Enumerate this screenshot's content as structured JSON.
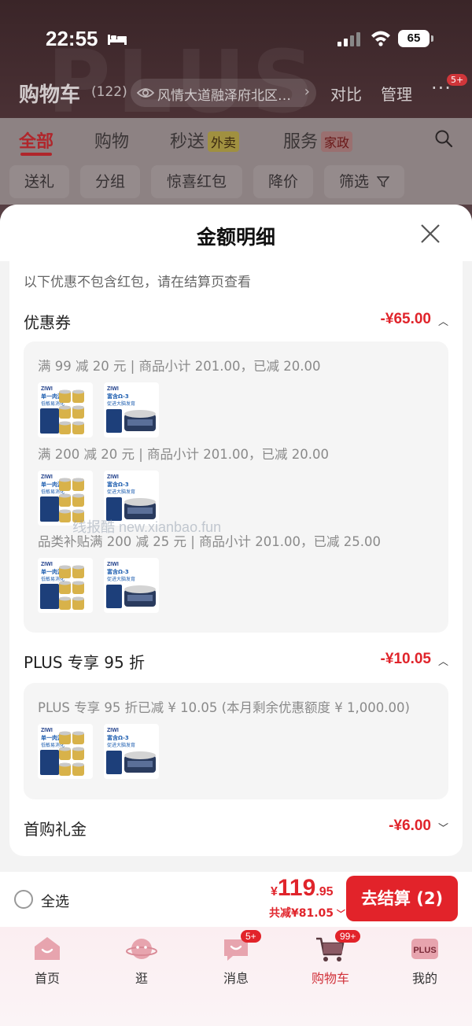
{
  "status_bar": {
    "time": "22:55",
    "battery": "65"
  },
  "header": {
    "title": "购物车",
    "count": "(122)",
    "address": "风情大道融泽府北区…",
    "compare": "对比",
    "manage": "管理",
    "more_badge": "5+"
  },
  "tabs": [
    {
      "label": "全部"
    },
    {
      "label": "购物"
    },
    {
      "label": "秒送",
      "tag": "外卖"
    },
    {
      "label": "服务",
      "tag": "家政"
    }
  ],
  "chips": [
    "送礼",
    "分组",
    "惊喜红包",
    "降价",
    "筛选"
  ],
  "sheet": {
    "title": "金额明细",
    "notice": "以下优惠不包含红包，请在结算页查看",
    "coupon": {
      "title": "优惠券",
      "amount": "-¥65.00",
      "rules": [
        "满 99 减 20 元 | 商品小计 201.00，已减 20.00",
        "满 200 减 20 元 | 商品小计 201.00，已减 20.00",
        "品类补贴满 200 减 25 元 | 商品小计 201.00，已减 25.00"
      ]
    },
    "plus": {
      "title": "PLUS 专享 95 折",
      "amount": "-¥10.05",
      "rule": "PLUS 专享 95 折已减 ¥ 10.05 (本月剩余优惠额度 ¥ 1,000.00)"
    },
    "first_gift": {
      "title": "首购礼金",
      "amount": "-¥6.00"
    },
    "products": [
      {
        "brand": "ZIWI",
        "line1": "单一肉源",
        "line2": "低敏易消化"
      },
      {
        "brand": "ZIWI",
        "line1": "富含Ω-3",
        "line2": "促进大脑发育"
      }
    ],
    "watermark": "线报酷 new.xianbao.fun"
  },
  "checkout": {
    "select_all": "全选",
    "price_symbol": "¥",
    "price_int": "119",
    "price_dec": ".95",
    "saved": "共减¥81.05",
    "button": "去结算 (2)"
  },
  "tabbar": [
    {
      "label": "首页",
      "icon": "home-icon"
    },
    {
      "label": "逛",
      "icon": "planet-icon"
    },
    {
      "label": "消息",
      "icon": "message-icon",
      "badge": "5+"
    },
    {
      "label": "购物车",
      "icon": "cart-icon",
      "badge": "99+",
      "active": true
    },
    {
      "label": "我的",
      "icon": "plus-member-icon",
      "icon_text": "PLUS"
    }
  ],
  "colors": {
    "accent": "#e2232a",
    "discount": "#e0242b"
  }
}
